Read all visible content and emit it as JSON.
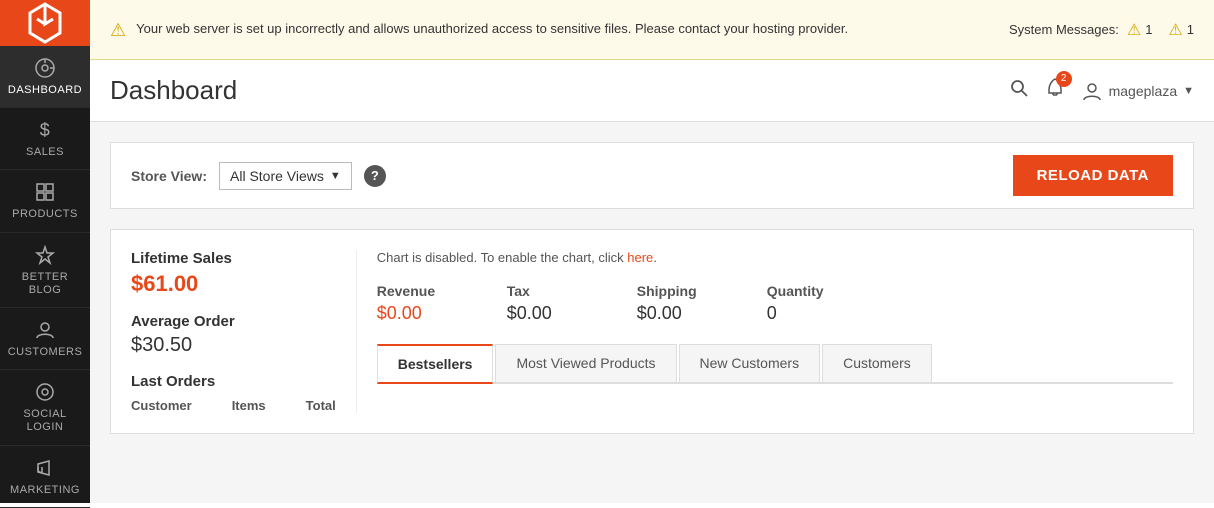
{
  "sidebar": {
    "logo_alt": "Magento Logo",
    "items": [
      {
        "id": "dashboard",
        "label": "Dashboard",
        "icon": "⊙",
        "active": true
      },
      {
        "id": "sales",
        "label": "Sales",
        "icon": "$",
        "active": false
      },
      {
        "id": "products",
        "label": "Products",
        "icon": "◈",
        "active": false
      },
      {
        "id": "better-blog",
        "label": "Better Blog",
        "icon": "✦",
        "active": false
      },
      {
        "id": "customers",
        "label": "Customers",
        "icon": "👤",
        "active": false
      },
      {
        "id": "social-login",
        "label": "Social Login",
        "icon": "◉",
        "active": false
      },
      {
        "id": "marketing",
        "label": "Marketing",
        "icon": "📢",
        "active": false
      }
    ]
  },
  "warning": {
    "text": "Your web server is set up incorrectly and allows unauthorized access to sensitive files. Please contact your hosting provider.",
    "system_messages_label": "System Messages:",
    "count1": "1",
    "count2": "1"
  },
  "header": {
    "title": "Dashboard",
    "notification_count": "2",
    "user_name": "mageplaza",
    "search_placeholder": "Search..."
  },
  "store_view": {
    "label": "Store View:",
    "selected": "All Store Views",
    "reload_label": "Reload Data"
  },
  "stats": {
    "lifetime_sales_label": "Lifetime Sales",
    "lifetime_sales_value": "$61.00",
    "avg_order_label": "Average Order",
    "avg_order_value": "$30.50",
    "last_orders_label": "Last Orders",
    "last_orders_cols": [
      "Customer",
      "Items",
      "Total"
    ],
    "chart_msg_prefix": "Chart is disabled. To enable the chart, click ",
    "chart_msg_link": "here",
    "metrics": [
      {
        "id": "revenue",
        "label": "Revenue",
        "value": "$0.00",
        "highlight": true
      },
      {
        "id": "tax",
        "label": "Tax",
        "value": "$0.00",
        "highlight": false
      },
      {
        "id": "shipping",
        "label": "Shipping",
        "value": "$0.00",
        "highlight": false
      },
      {
        "id": "quantity",
        "label": "Quantity",
        "value": "0",
        "highlight": false
      }
    ]
  },
  "tabs": [
    {
      "id": "bestsellers",
      "label": "Bestsellers",
      "active": true
    },
    {
      "id": "most-viewed",
      "label": "Most Viewed Products",
      "active": false
    },
    {
      "id": "new-customers",
      "label": "New Customers",
      "active": false
    },
    {
      "id": "customers",
      "label": "Customers",
      "active": false
    }
  ],
  "scrollbar": {
    "visible": true
  }
}
